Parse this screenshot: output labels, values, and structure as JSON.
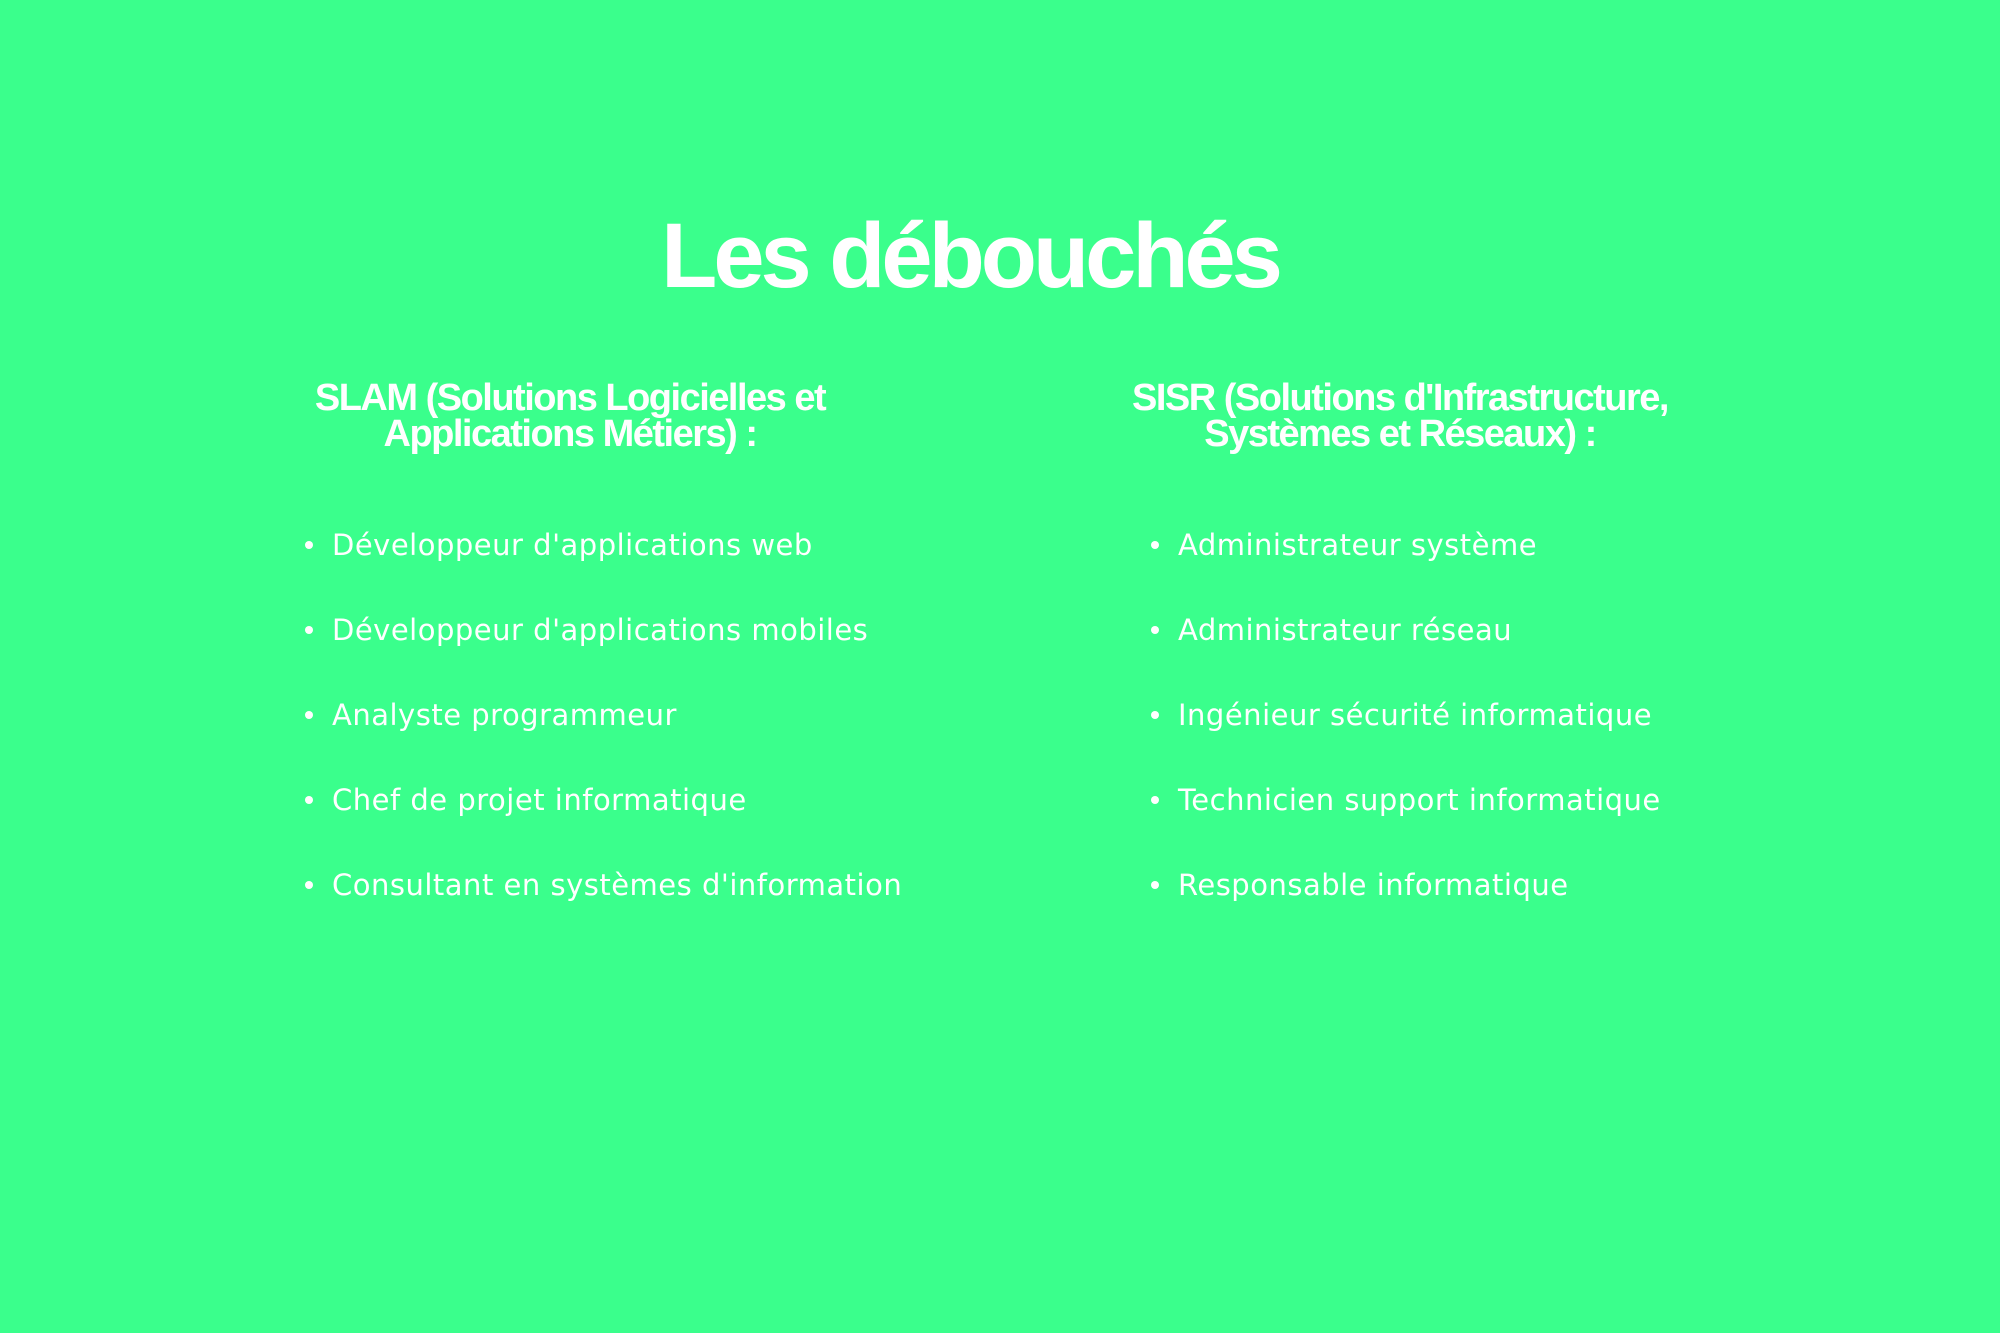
{
  "title": "Les débouchés",
  "slam": {
    "heading": "SLAM (Solutions Logicielles et Applications Métiers) :",
    "items": [
      "Développeur d'applications web",
      "Développeur d'applications mobiles",
      "Analyste programmeur",
      "Chef de projet informatique",
      "Consultant en systèmes d'information"
    ]
  },
  "sisr": {
    "heading": "SISR (Solutions d'Infrastructure, Systèmes et Réseaux) :",
    "items": [
      "Administrateur système",
      "Administrateur réseau",
      "Ingénieur sécurité informatique",
      "Technicien support informatique",
      "Responsable informatique"
    ]
  },
  "colors": {
    "background": "#3aff8c",
    "text": "#ffffff"
  }
}
